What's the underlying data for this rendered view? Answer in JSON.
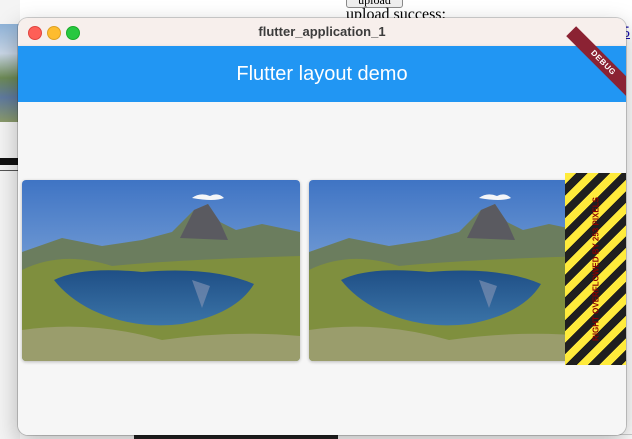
{
  "background": {
    "upload_button_label": "upload",
    "upload_status": "upload success:",
    "link_fragment": "5"
  },
  "window": {
    "title": "flutter_application_1"
  },
  "appbar": {
    "title": "Flutter layout demo",
    "color": "#2196f3"
  },
  "debug_banner": {
    "label": "DEBUG",
    "color": "#8b2233"
  },
  "overflow": {
    "message": "RIGHT OVERFLOWED BY 253 PIXELS",
    "stripe_colors": [
      "#ffeb3b",
      "#1f1f1f"
    ]
  },
  "images": [
    {
      "subject": "mountain-lake-photo"
    },
    {
      "subject": "mountain-lake-photo"
    }
  ]
}
